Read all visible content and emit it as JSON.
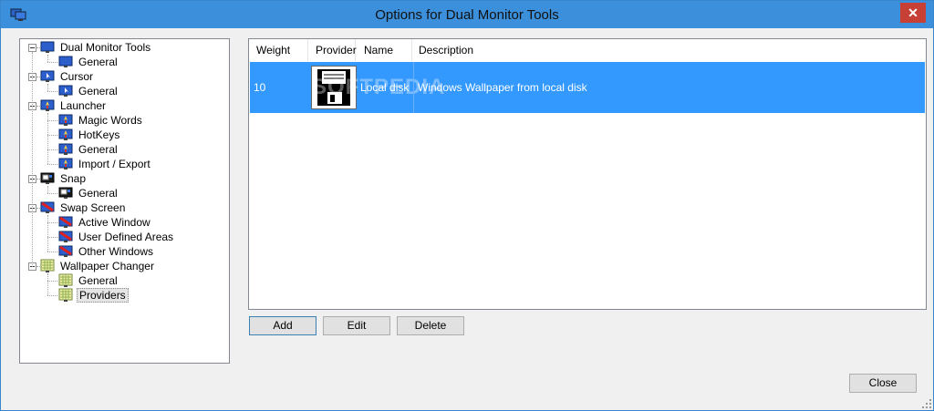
{
  "window": {
    "title": "Options for Dual Monitor Tools",
    "close_label": "✕"
  },
  "tree": {
    "nodes": [
      {
        "label": "Dual Monitor Tools",
        "icon": "dual-monitor-icon"
      },
      {
        "label": "General",
        "icon": "dual-monitor-icon"
      },
      {
        "label": "Cursor",
        "icon": "cursor-monitor-icon"
      },
      {
        "label": "General",
        "icon": "cursor-monitor-icon"
      },
      {
        "label": "Launcher",
        "icon": "launcher-icon"
      },
      {
        "label": "Magic Words",
        "icon": "launcher-icon"
      },
      {
        "label": "HotKeys",
        "icon": "launcher-icon"
      },
      {
        "label": "General",
        "icon": "launcher-icon"
      },
      {
        "label": "Import / Export",
        "icon": "launcher-icon"
      },
      {
        "label": "Snap",
        "icon": "snap-icon"
      },
      {
        "label": "General",
        "icon": "snap-icon"
      },
      {
        "label": "Swap Screen",
        "icon": "swap-screen-icon"
      },
      {
        "label": "Active Window",
        "icon": "swap-screen-icon"
      },
      {
        "label": "User Defined Areas",
        "icon": "swap-screen-icon"
      },
      {
        "label": "Other Windows",
        "icon": "swap-screen-icon"
      },
      {
        "label": "Wallpaper Changer",
        "icon": "wallpaper-icon"
      },
      {
        "label": "General",
        "icon": "wallpaper-icon"
      },
      {
        "label": "Providers",
        "icon": "wallpaper-icon"
      }
    ]
  },
  "providers": {
    "columns": [
      "Weight",
      "Provider",
      "Name",
      "Description"
    ],
    "rows": [
      {
        "weight": "10",
        "provider_icon": "floppy-disk-icon",
        "name": "Local disk",
        "description": "Windows Wallpaper from local disk"
      }
    ],
    "watermark": "SOFTPEDIA"
  },
  "buttons": {
    "add": "Add",
    "edit": "Edit",
    "delete": "Delete",
    "close": "Close"
  },
  "colors": {
    "selection": "#3399ff",
    "titlebar": "#3b8fdb"
  }
}
